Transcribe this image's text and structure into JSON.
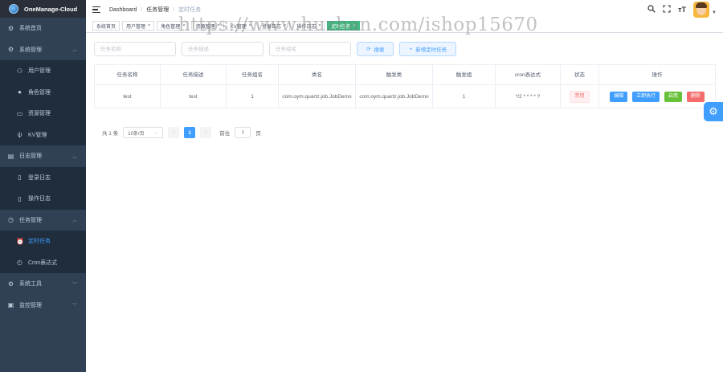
{
  "app": {
    "title": "OneManage-Cloud"
  },
  "sidebar": {
    "items": [
      {
        "label": "系统首页",
        "icon": "dashboard-icon"
      },
      {
        "label": "系统管理",
        "icon": "gear-icon",
        "expanded": true
      },
      {
        "label": "用户管理",
        "icon": "user-icon"
      },
      {
        "label": "角色管理",
        "icon": "role-icon"
      },
      {
        "label": "资源管理",
        "icon": "resource-icon"
      },
      {
        "label": "KV管理",
        "icon": "kv-icon"
      },
      {
        "label": "日志管理",
        "icon": "log-icon",
        "expanded": true
      },
      {
        "label": "登录日志",
        "icon": "document-icon"
      },
      {
        "label": "操作日志",
        "icon": "document-icon"
      },
      {
        "label": "任务管理",
        "icon": "clock-icon",
        "expanded": true
      },
      {
        "label": "定时任务",
        "icon": "alarm-icon",
        "active": true
      },
      {
        "label": "Cron表达式",
        "icon": "timer-icon"
      },
      {
        "label": "系统工具",
        "icon": "gear-icon",
        "expanded": false
      },
      {
        "label": "监控管理",
        "icon": "monitor-icon",
        "expanded": false
      }
    ]
  },
  "navbar": {
    "breadcrumb": [
      "Dashboard",
      "任务管理",
      "定时任务"
    ],
    "icons": [
      "search-icon",
      "fullscreen-icon",
      "font-size-icon",
      "avatar"
    ]
  },
  "tags": [
    {
      "label": "系统首页"
    },
    {
      "label": "用户管理"
    },
    {
      "label": "角色管理"
    },
    {
      "label": "资源管理"
    },
    {
      "label": "KV管理"
    },
    {
      "label": "登录日志"
    },
    {
      "label": "操作日志"
    },
    {
      "label": "定时任务",
      "active": true
    }
  ],
  "search": {
    "name_placeholder": "任务名称",
    "desc_placeholder": "任务描述",
    "group_placeholder": "任务组名",
    "search_label": "搜索",
    "add_label": "新增定时任务"
  },
  "table": {
    "headers": [
      "任务名称",
      "任务描述",
      "任务组名",
      "类名",
      "触发类",
      "触发组",
      "cron表达式",
      "状态",
      "操作"
    ],
    "rows": [
      {
        "name": "test",
        "desc": "test",
        "group": "1",
        "class": "com.oym.quartz.job.JobDemo",
        "trigger": "com.oym.quartz.job.JobDemo",
        "trigger_group": "1",
        "cron": "*/2 * * * * ?",
        "status": "禁用",
        "actions": [
          "编辑",
          "立即执行",
          "启用",
          "删除"
        ]
      }
    ]
  },
  "pagination": {
    "total_text": "共 1 条",
    "page_size": "10条/页",
    "current_page": "1",
    "goto_prefix": "前往",
    "goto_value": "1",
    "goto_suffix": "页"
  },
  "watermark": "https://www.huzhan.com/ishop15670",
  "colors": {
    "primary": "#409eff",
    "success": "#67c23a",
    "danger": "#f56c6c",
    "sidebar": "#304156"
  }
}
